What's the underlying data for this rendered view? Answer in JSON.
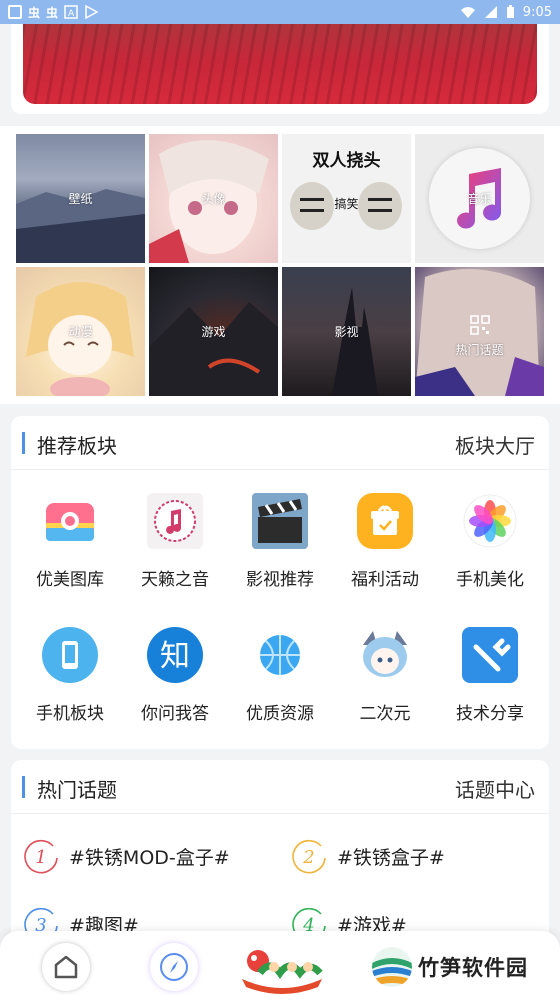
{
  "status_bar": {
    "time": "9:05",
    "left_glyphs": [
      "虫",
      "虫"
    ]
  },
  "grid_tiles": [
    {
      "label": "壁纸"
    },
    {
      "label": "头像"
    },
    {
      "label": "搞笑",
      "overlay_text": "双人挠头"
    },
    {
      "label": "音乐"
    },
    {
      "label": "动漫"
    },
    {
      "label": "游戏"
    },
    {
      "label": "影视"
    },
    {
      "label": "热门话题"
    }
  ],
  "recommend": {
    "title": "推荐板块",
    "more": "板块大厅",
    "items": [
      {
        "label": "优美图库",
        "icon": "camera-icon"
      },
      {
        "label": "天籁之音",
        "icon": "music-note-icon"
      },
      {
        "label": "影视推荐",
        "icon": "clapperboard-icon"
      },
      {
        "label": "福利活动",
        "icon": "gift-icon"
      },
      {
        "label": "手机美化",
        "icon": "flower-icon"
      },
      {
        "label": "手机板块",
        "icon": "phone-icon"
      },
      {
        "label": "你问我答",
        "icon": "zhi-icon",
        "icon_text": "知"
      },
      {
        "label": "优质资源",
        "icon": "basketball-icon"
      },
      {
        "label": "二次元",
        "icon": "anime-girl-icon"
      },
      {
        "label": "技术分享",
        "icon": "wrench-icon"
      }
    ]
  },
  "topics": {
    "title": "热门话题",
    "more": "话题中心",
    "items": [
      {
        "num": "1",
        "label": "#铁锈MOD-盒子#",
        "color": "#e0505a"
      },
      {
        "num": "2",
        "label": "#铁锈盒子#",
        "color": "#f0b43c"
      },
      {
        "num": "3",
        "label": "#趣图#",
        "color": "#4f8fe6"
      },
      {
        "num": "4",
        "label": "#游戏#",
        "color": "#35b35a"
      }
    ]
  },
  "watermark": {
    "text": "竹笋软件园"
  },
  "colors": {
    "accent": "#4f8fe6",
    "status_bar": "#8fb8ee"
  }
}
